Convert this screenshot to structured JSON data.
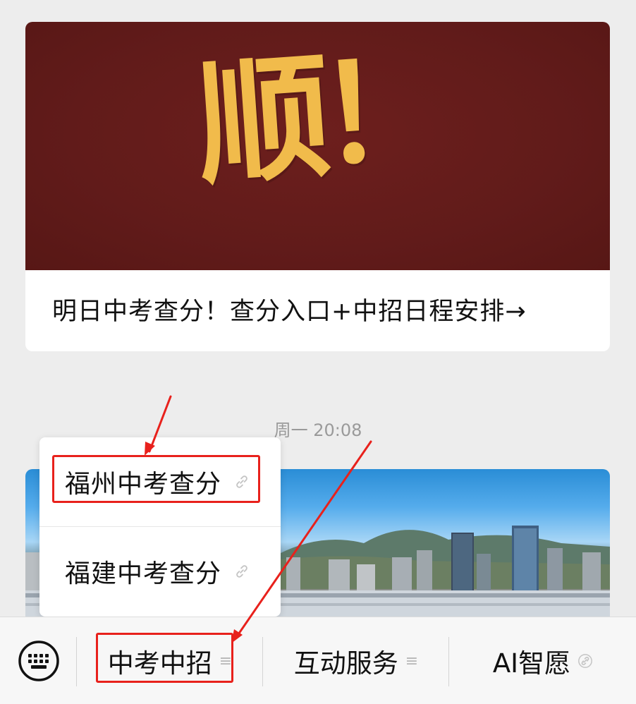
{
  "article_card": {
    "cover_text": "顺！",
    "title": "明日中考查分！查分入口+中招日程安排→"
  },
  "timestamp": "周一 20:08",
  "popup_menu": {
    "items": [
      {
        "label": "福州中考查分",
        "icon": "link-icon"
      },
      {
        "label": "福建中考查分",
        "icon": "link-icon"
      }
    ]
  },
  "menubar": {
    "keyboard_icon": "keyboard-icon",
    "items": [
      {
        "label": "中考中招",
        "icon": "menu-list-icon",
        "glyph": "≡"
      },
      {
        "label": "互动服务",
        "icon": "menu-list-icon",
        "glyph": "≡"
      },
      {
        "label": "AI智愿",
        "icon": "link-icon"
      }
    ]
  },
  "colors": {
    "annotation": "#e8211c",
    "cover_background": "#611b1a",
    "cover_text": "#f1bb4b"
  }
}
